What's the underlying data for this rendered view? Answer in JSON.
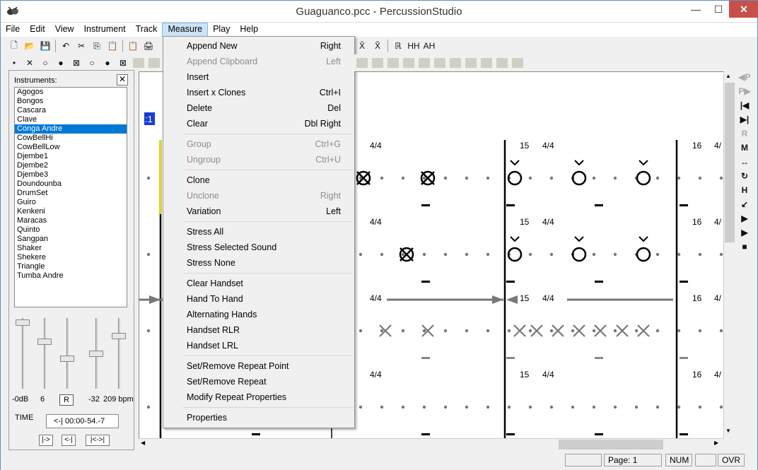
{
  "window": {
    "title": "Guaguanco.pcc - PercussionStudio",
    "min_symbol": "—",
    "max_symbol": "☐",
    "close_symbol": "✕"
  },
  "menubar": [
    "File",
    "Edit",
    "View",
    "Instrument",
    "Track",
    "Measure",
    "Play",
    "Help"
  ],
  "active_menu": "Measure",
  "toolbar1_symbols": [
    "🗋",
    "📂",
    "💾",
    "↶",
    "✂",
    "⎘",
    "📋",
    "📋",
    "🖨"
  ],
  "toolbar1_right_symbols": [
    "X̆",
    "X̌",
    "ℝ",
    "HH",
    "AH"
  ],
  "toolbar2_symbols": [
    "•",
    "✕",
    "○",
    "●",
    "⊠",
    "○",
    "●",
    "⊠"
  ],
  "instruments": {
    "label": "Instruments:",
    "close_symbol": "✕",
    "items": [
      "Agogos",
      "Bongos",
      "Cascara",
      "Clave",
      "Conga Andre",
      "CowBellHi",
      "CowBellLow",
      "Djembe1",
      "Djembe2",
      "Djembe3",
      "Doundounba",
      "DrumSet",
      "Guiro",
      "Kenkeni",
      "Maracas",
      "Quinto",
      "Sangpan",
      "Shaker",
      "Shekere",
      "Triangle",
      "Tumba Andre"
    ],
    "selected": "Conga Andre",
    "selected_index": 4
  },
  "mixer": {
    "volume": "-0dB",
    "value2": "6",
    "reset_label": "R",
    "value4": "-32",
    "tempo": "209 bpm",
    "levels": [
      0.98,
      0.68,
      0.42,
      0.5,
      0.77
    ]
  },
  "time": {
    "label": "TIME",
    "value": "<-|  00:00-54.-7"
  },
  "transport": [
    "|->",
    "<-|",
    "|<->|"
  ],
  "score": {
    "marker": ":1",
    "measures": [
      {
        "number": "",
        "sig": "4/4"
      },
      {
        "number": "15",
        "sig": "4/4"
      },
      {
        "number": "16",
        "sig": "4/"
      }
    ]
  },
  "measure_menu": {
    "groups": [
      [
        {
          "label": "Append New",
          "shortcut": "Right",
          "enabled": true
        },
        {
          "label": "Append Clipboard",
          "shortcut": "Left",
          "enabled": false
        },
        {
          "label": "Insert",
          "shortcut": "",
          "enabled": true
        },
        {
          "label": "Insert x Clones",
          "shortcut": "Ctrl+I",
          "enabled": true
        },
        {
          "label": "Delete",
          "shortcut": "Del",
          "enabled": true
        },
        {
          "label": "Clear",
          "shortcut": "Dbl Right",
          "enabled": true
        }
      ],
      [
        {
          "label": "Group",
          "shortcut": "Ctrl+G",
          "enabled": false
        },
        {
          "label": "Ungroup",
          "shortcut": "Ctrl+U",
          "enabled": false
        }
      ],
      [
        {
          "label": "Clone",
          "shortcut": "",
          "enabled": true
        },
        {
          "label": "Unclone",
          "shortcut": "Right",
          "enabled": false
        },
        {
          "label": "Variation",
          "shortcut": "Left",
          "enabled": true
        }
      ],
      [
        {
          "label": "Stress All",
          "shortcut": "",
          "enabled": true
        },
        {
          "label": "Stress Selected Sound",
          "shortcut": "",
          "enabled": true
        },
        {
          "label": "Stress None",
          "shortcut": "",
          "enabled": true
        }
      ],
      [
        {
          "label": "Clear Handset",
          "shortcut": "",
          "enabled": true
        },
        {
          "label": "Hand To Hand",
          "shortcut": "",
          "enabled": true
        },
        {
          "label": "Alternating Hands",
          "shortcut": "",
          "enabled": true
        },
        {
          "label": "Handset RLR",
          "shortcut": "",
          "enabled": true
        },
        {
          "label": "Handset LRL",
          "shortcut": "",
          "enabled": true
        }
      ],
      [
        {
          "label": "Set/Remove Repeat Point",
          "shortcut": "",
          "enabled": true
        },
        {
          "label": "Set/Remove Repeat",
          "shortcut": "",
          "enabled": true
        },
        {
          "label": "Modify Repeat Properties",
          "shortcut": "",
          "enabled": true
        }
      ],
      [
        {
          "label": "Properties",
          "shortcut": "",
          "enabled": true
        }
      ]
    ]
  },
  "right_toolbar_symbols": [
    "◀P",
    "P▶",
    "|◀",
    "▶|",
    "R",
    "M",
    "↔",
    "↻",
    "H",
    "↙",
    "▶",
    "▶",
    "■"
  ],
  "status": {
    "page": "Page: 1",
    "num": "NUM",
    "ovr": "OVR"
  }
}
